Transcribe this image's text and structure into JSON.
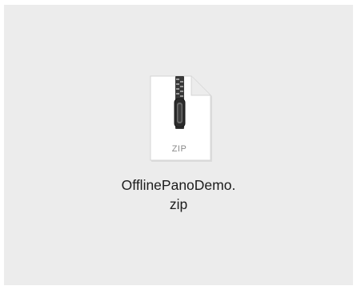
{
  "desktop": {
    "background_color": "#ececec",
    "file": {
      "icon": "zip-archive-icon",
      "extension_label": "ZIP",
      "name_line1": "OfflinePanoDemo.",
      "name_line2": "zip"
    }
  }
}
